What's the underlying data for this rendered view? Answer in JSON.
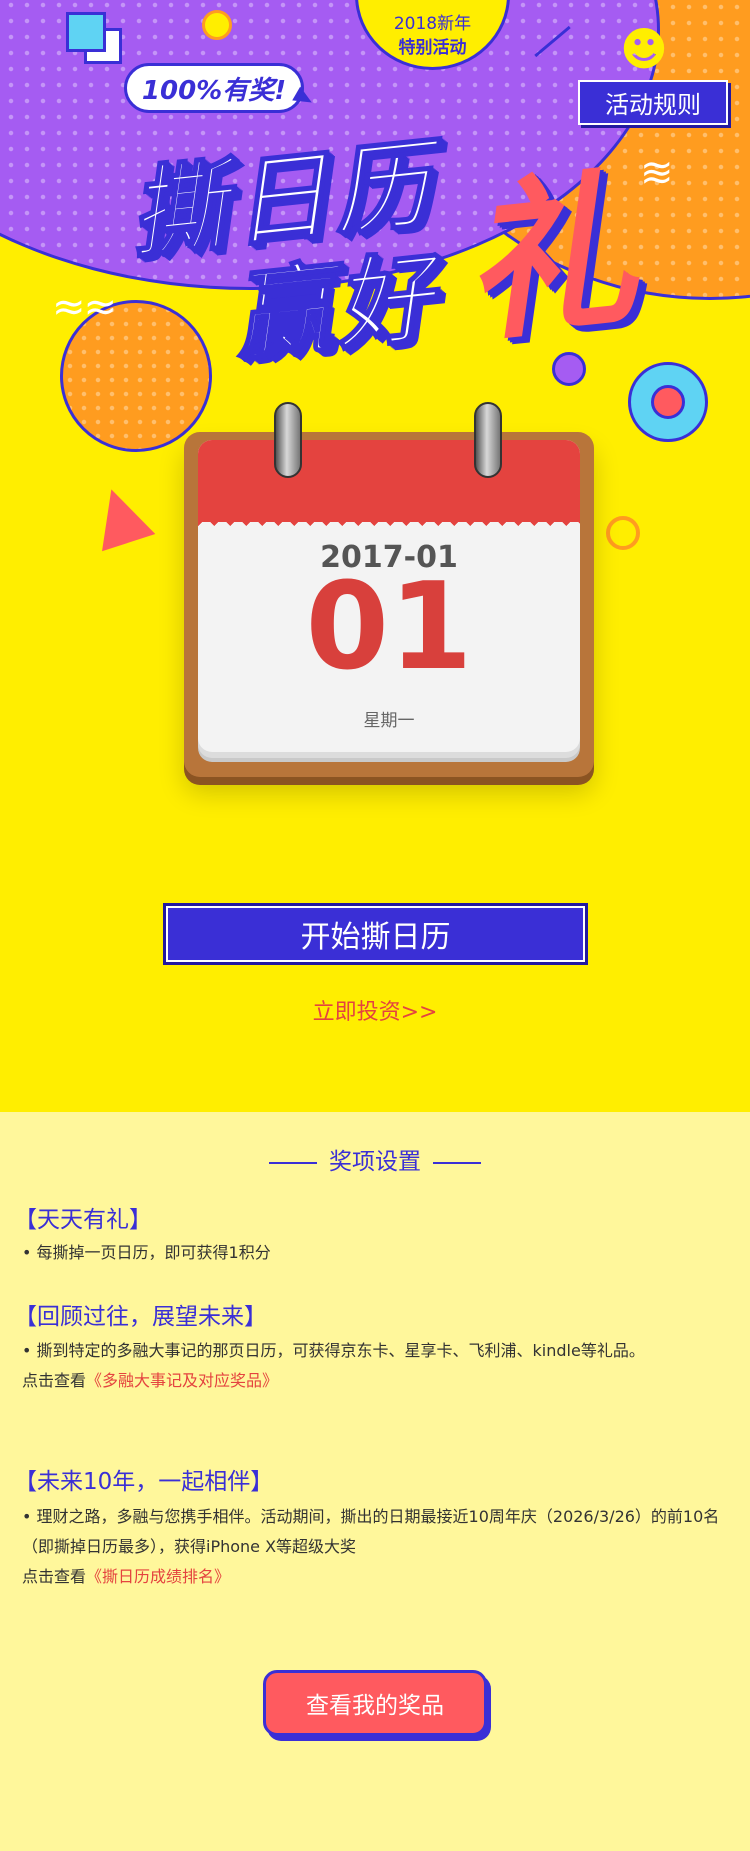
{
  "badge": {
    "year": "2018新年",
    "subtitle": "特别活动"
  },
  "pill": {
    "text": "100%有奖!"
  },
  "rules_button": "活动规则",
  "title": {
    "line1": "撕日历",
    "line2": "赢好",
    "gift": "礼"
  },
  "calendar": {
    "date": "2017-01",
    "day": "01",
    "weekday": "星期一"
  },
  "actions": {
    "start_button": "开始撕日历",
    "invest_link": "立即投资>>"
  },
  "prizes": {
    "heading": "奖项设置",
    "daily": {
      "title": "【天天有礼】",
      "text": "• 每撕掉一页日历，即可获得1积分"
    },
    "review": {
      "title": "【回顾过往，展望未来】",
      "text": "• 撕到特定的多融大事记的那页日历，可获得京东卡、星享卡、飞利浦、kindle等礼品。",
      "link_prefix": "点击查看",
      "link": "《多融大事记及对应奖品》"
    },
    "future": {
      "title": "【未来10年，一起相伴】",
      "text": "• 理财之路，多融与您携手相伴。活动期间，撕出的日期最接近10周年庆（2026/3/26）的前10名（即撕掉日历最多），获得iPhone X等超级大奖",
      "link_prefix": "点击查看",
      "link": "《撕日历成绩排名》"
    }
  },
  "my_prize_button": "查看我的奖品",
  "colors": {
    "blue": "#3a2fd6",
    "yellow": "#ffee00",
    "red": "#e4433f",
    "pink": "#ff5a5f",
    "purple": "#a55cf2",
    "orange": "#ff9c1f",
    "cream": "#fff79b"
  },
  "icons": [
    "smiley-icon",
    "zigzag-icon",
    "wave-icon",
    "calendar-ring-icon"
  ]
}
